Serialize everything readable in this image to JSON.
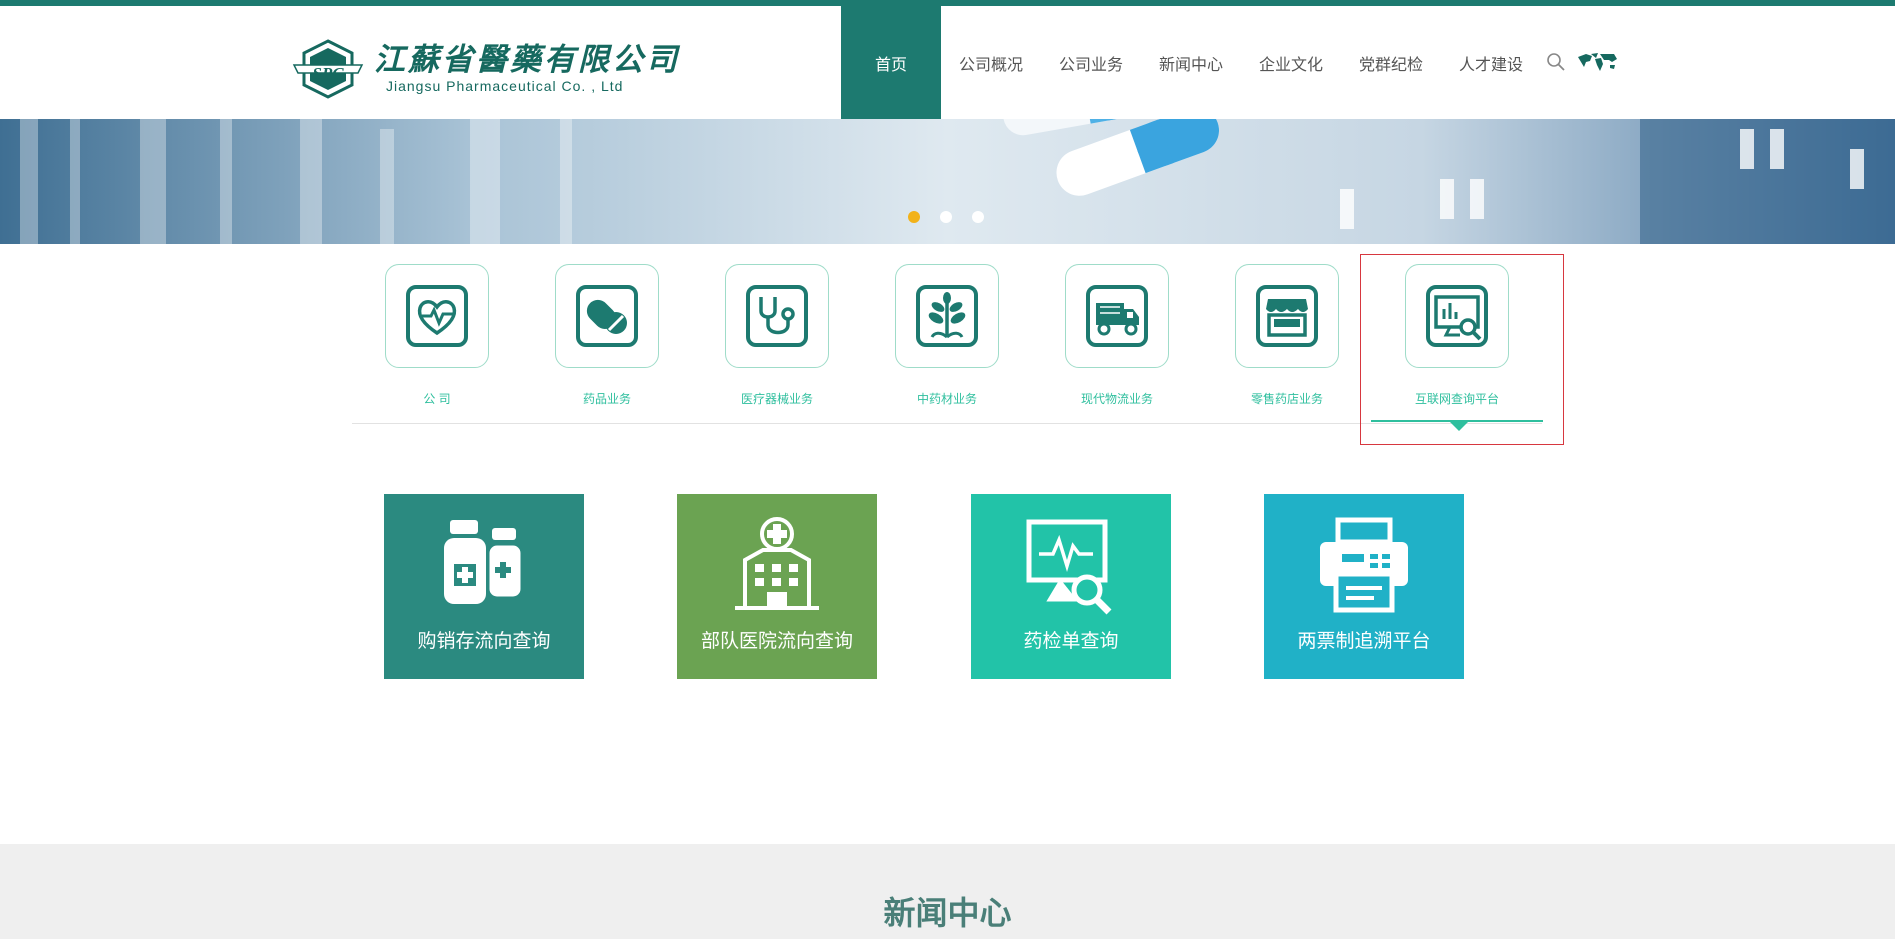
{
  "header": {
    "logo_cn": "江蘇省醫藥有限公司",
    "logo_en": "Jiangsu  Pharmaceutical  Co. , Ltd",
    "logo_mark": "SPC",
    "brand_color": "#1d7a70"
  },
  "nav": {
    "items": [
      {
        "label": "首页",
        "active": true
      },
      {
        "label": "公司概况"
      },
      {
        "label": "公司业务"
      },
      {
        "label": "新闻中心"
      },
      {
        "label": "企业文化"
      },
      {
        "label": "党群纪检"
      },
      {
        "label": "人才建设"
      }
    ],
    "search_icon": "search-icon",
    "language_icon": "world-map-icon"
  },
  "banner": {
    "slides": 3,
    "active_slide": 1,
    "dot_active_color": "#f2b21a"
  },
  "business": {
    "items": [
      {
        "label": "公  司",
        "icon": "heart-pulse-icon"
      },
      {
        "label": "药品业务",
        "icon": "pill-capsule-icon"
      },
      {
        "label": "医疗器械业务",
        "icon": "stethoscope-icon"
      },
      {
        "label": "中药材业务",
        "icon": "herb-tree-icon"
      },
      {
        "label": "现代物流业务",
        "icon": "truck-icon"
      },
      {
        "label": "零售药店业务",
        "icon": "storefront-icon"
      },
      {
        "label": "互联网查询平台",
        "icon": "monitor-search-icon",
        "active": true
      }
    ],
    "accent_color": "#2fbf9e"
  },
  "query_tiles": [
    {
      "label": "购销存流向查询",
      "icon": "medicine-bottles-icon",
      "color": "#2b8a80"
    },
    {
      "label": "部队医院流向查询",
      "icon": "hospital-icon",
      "color": "#6ba352"
    },
    {
      "label": "药检单查询",
      "icon": "monitor-pulse-search-icon",
      "color": "#22c3a8"
    },
    {
      "label": "两票制追溯平台",
      "icon": "printer-icon",
      "color": "#20b1c7"
    }
  ],
  "news": {
    "title": "新闻中心"
  }
}
